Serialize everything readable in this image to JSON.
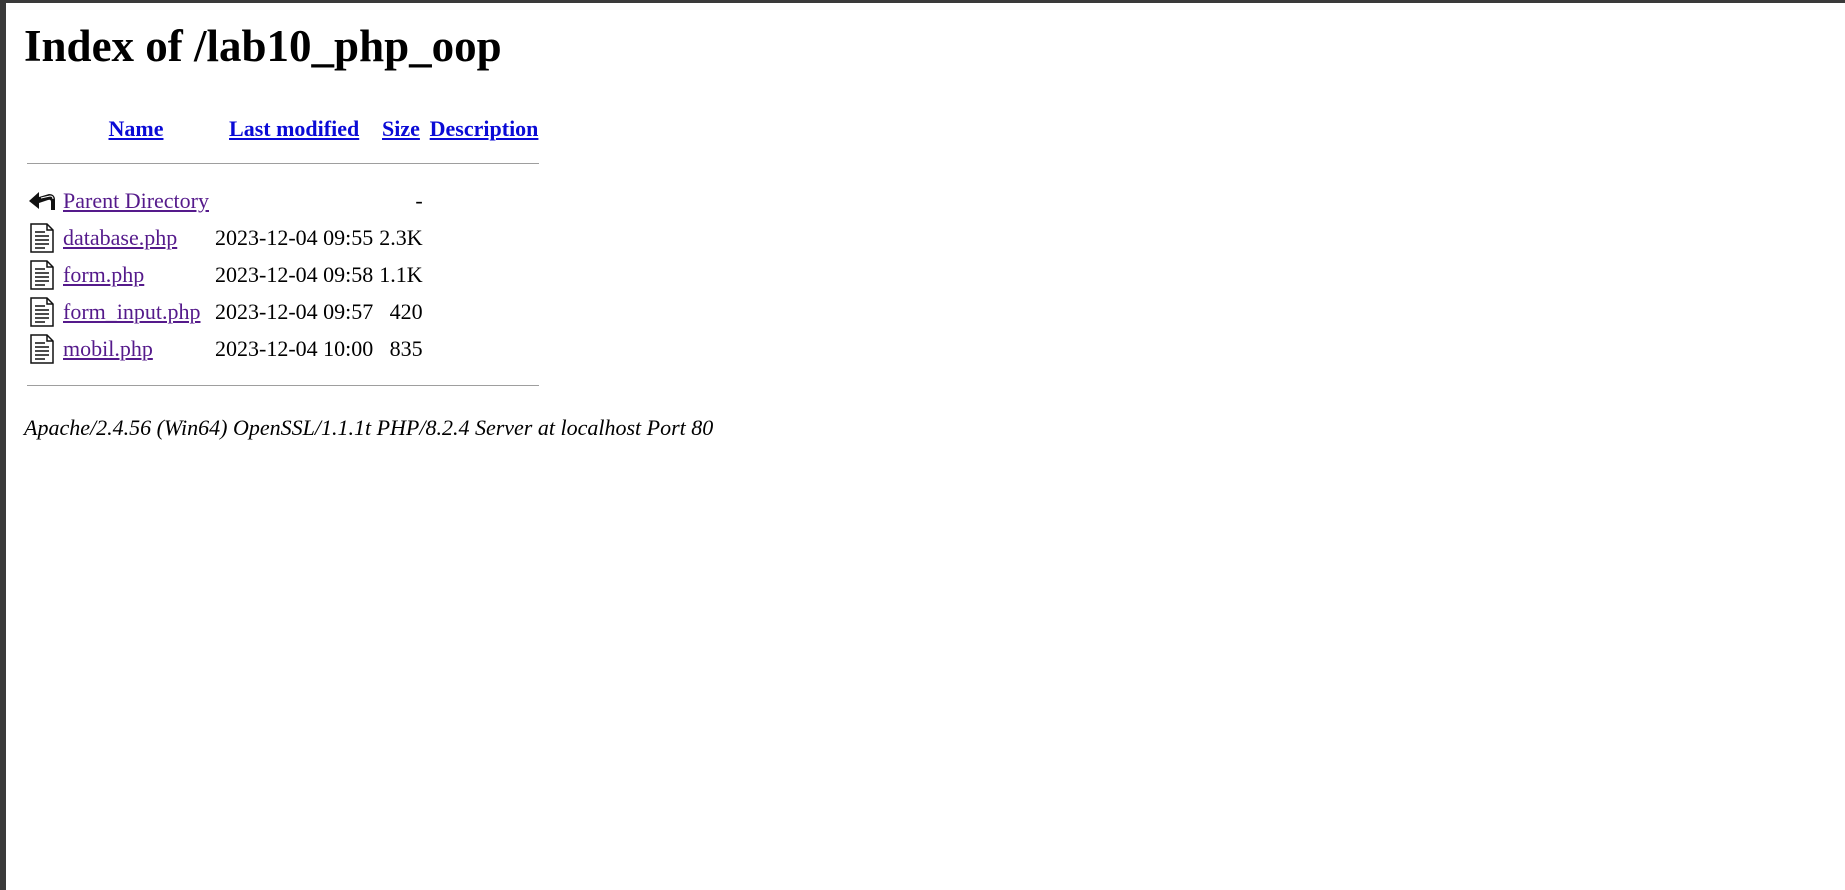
{
  "page": {
    "title": "Index of /lab10_php_oop"
  },
  "columns": {
    "name": "Name",
    "last_modified": "Last modified",
    "size": "Size",
    "description": "Description"
  },
  "parent": {
    "icon": "back-arrow-icon",
    "label": "Parent Directory",
    "size": "-"
  },
  "files": [
    {
      "icon": "document-icon",
      "name": "database.php",
      "modified": "2023-12-04 09:55",
      "size": "2.3K",
      "description": ""
    },
    {
      "icon": "document-icon",
      "name": "form.php",
      "modified": "2023-12-04 09:58",
      "size": "1.1K",
      "description": ""
    },
    {
      "icon": "document-icon",
      "name": "form_input.php",
      "modified": "2023-12-04 09:57",
      "size": "420",
      "description": ""
    },
    {
      "icon": "document-icon",
      "name": "mobil.php",
      "modified": "2023-12-04 10:00",
      "size": "835",
      "description": ""
    }
  ],
  "footer": {
    "server_signature": "Apache/2.4.56 (Win64) OpenSSL/1.1.1t PHP/8.2.4 Server at localhost Port 80"
  }
}
